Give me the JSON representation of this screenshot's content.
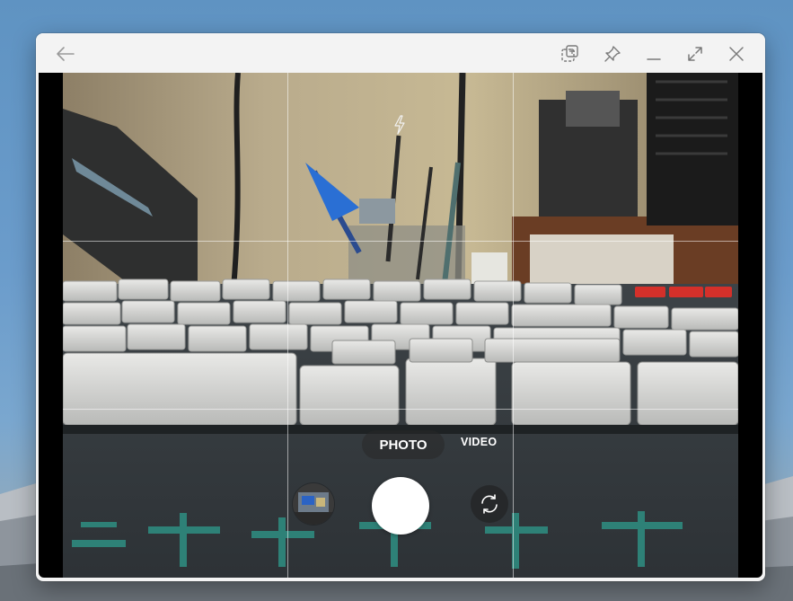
{
  "app": {
    "modes": {
      "photo": "PHOTO",
      "video": "VIDEO"
    },
    "selected_mode": "PHOTO",
    "flash_state": "auto-flash-icon",
    "grid": "3x3"
  },
  "titlebar": {
    "icons": [
      "back-arrow-icon",
      "screenshot-icon",
      "pin-icon",
      "minimize-icon",
      "maximize-icon",
      "close-icon"
    ]
  },
  "colors": {
    "titlebar_bg": "#f3f3f3",
    "viewer_bg": "#000000",
    "shutter": "#ffffff",
    "keycap_accent": "#e0302a"
  }
}
